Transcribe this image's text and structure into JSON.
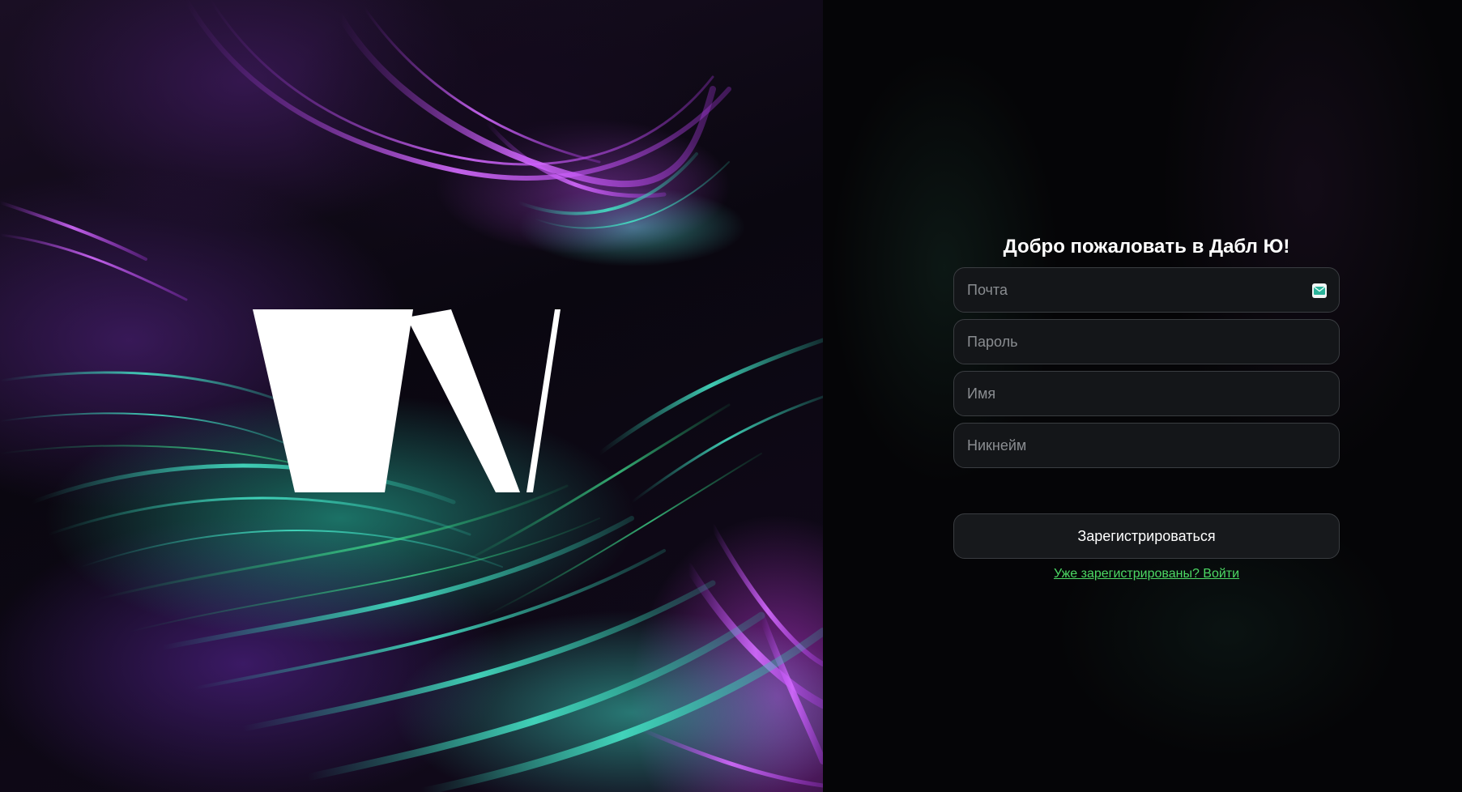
{
  "branding": {
    "logo_letter": "W",
    "logo_color": "#ffffff"
  },
  "register_form": {
    "title": "Добро пожаловать в Дабл Ю!",
    "email_placeholder": "Почта",
    "email_icon": "mail-icon",
    "password_placeholder": "Пароль",
    "name_placeholder": "Имя",
    "nickname_placeholder": "Никнейм",
    "submit_label": "Зарегистрироваться",
    "login_link": "Уже зарегистрированы? Войти"
  },
  "colors": {
    "link_green": "#4cd964",
    "field_background": "#141619",
    "field_border": "#3a3d41",
    "art_purple": "#c850ff",
    "art_teal": "#3cd2be"
  }
}
